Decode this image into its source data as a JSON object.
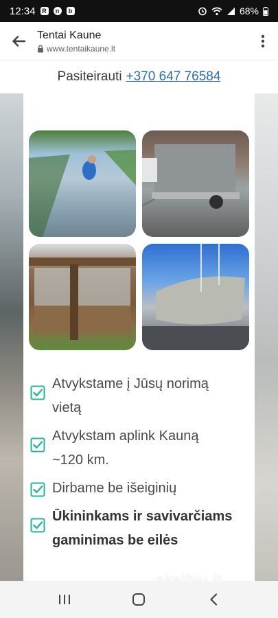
{
  "status": {
    "time": "12:34",
    "battery": "68%",
    "left_icons": [
      "r-icon",
      "notification-n-icon",
      "notification-b-icon"
    ],
    "right_icons": [
      "alarm-icon",
      "wifi-icon",
      "signal-icon",
      "battery-icon"
    ]
  },
  "browser": {
    "title": "Tentai Kaune",
    "url": "www.tentaikaune.lt"
  },
  "contact": {
    "label": "Pasiteirauti",
    "phone": "+370 647 76584"
  },
  "features": [
    {
      "text": "Atvykstame į Jūsų norimą vietą",
      "line1": "Atvykstame į Jūsų norimą",
      "line2": "vietą",
      "bold": false
    },
    {
      "text": "Atvykstam aplink Kauną ~120 km.",
      "line1": "Atvykstam aplink Kauną",
      "line2": "~120 km.",
      "bold": false
    },
    {
      "text": "Dirbame be išeiginių",
      "line1": "Dirbame be išeiginių",
      "line2": "",
      "bold": false
    },
    {
      "text": "Ūkininkams ir savivarčiams gaminimas be eilės",
      "line1": "Ūkininkams ir savivarčiams",
      "line2": "gaminimas be eilės",
      "bold": true
    }
  ],
  "watermark": "skelbiu.lt",
  "colors": {
    "check": "#27b39b",
    "link": "#2a6db5"
  }
}
